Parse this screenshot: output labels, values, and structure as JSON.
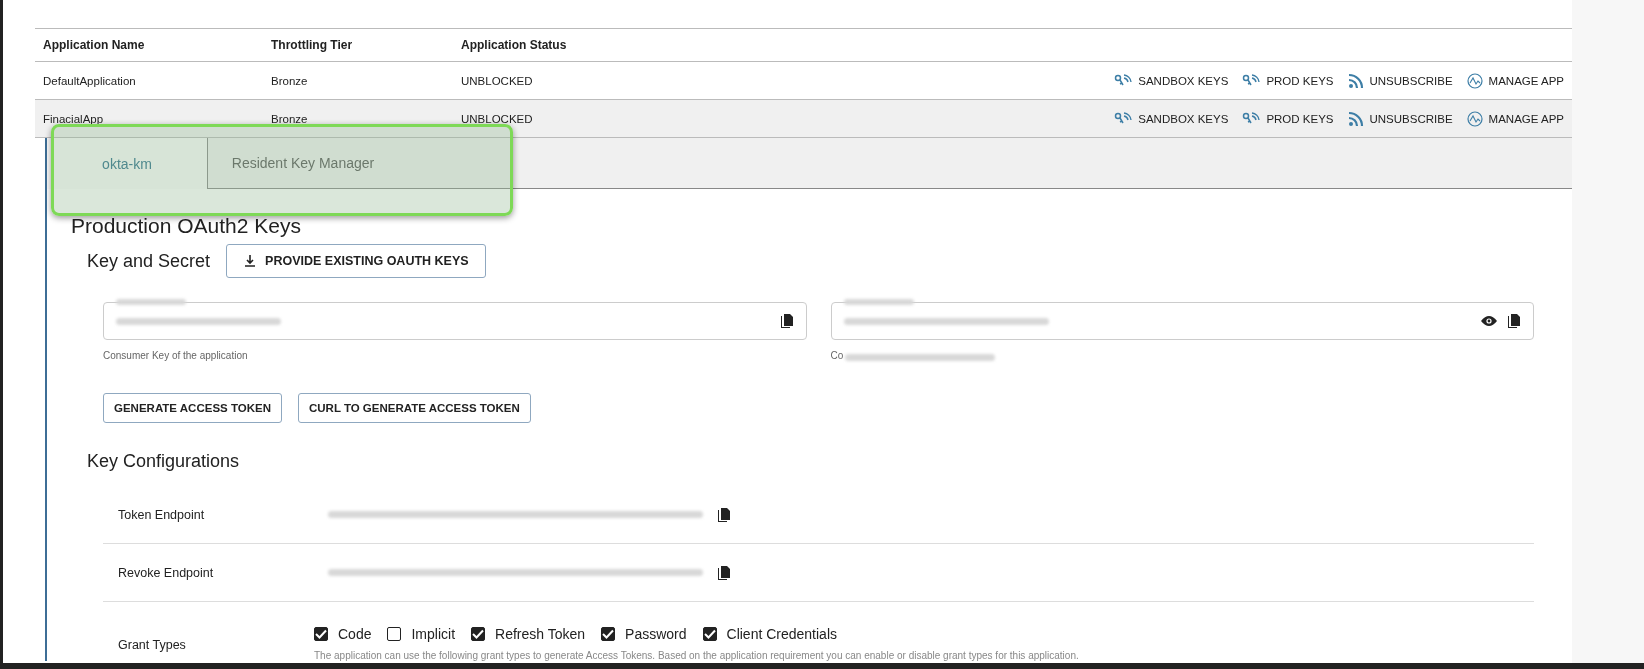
{
  "table": {
    "columns": [
      "Application Name",
      "Throttling Tier",
      "Application Status"
    ],
    "rows": [
      {
        "name": "DefaultApplication",
        "tier": "Bronze",
        "status": "UNBLOCKED",
        "selected": false,
        "actions": [
          "SANDBOX KEYS",
          "PROD KEYS",
          "UNSUBSCRIBE",
          "MANAGE APP"
        ]
      },
      {
        "name": "FinacialApp",
        "tier": "Bronze",
        "status": "UNBLOCKED",
        "selected": true,
        "actions": [
          "SANDBOX KEYS",
          "PROD KEYS",
          "UNSUBSCRIBE",
          "MANAGE APP"
        ]
      }
    ]
  },
  "tabs": [
    {
      "label": "okta-km",
      "selected": true
    },
    {
      "label": "Resident Key Manager",
      "selected": false
    }
  ],
  "highlight": {
    "on": true
  },
  "keys": {
    "title": "Production OAuth2 Keys",
    "section": "Key and Secret",
    "provide_button": "PROVIDE EXISTING OAUTH KEYS",
    "consumer_key": {
      "helper": "Consumer Key of the application"
    },
    "consumer_secret": {
      "helper": "Co"
    },
    "buttons": [
      "GENERATE ACCESS TOKEN",
      "CURL TO GENERATE ACCESS TOKEN"
    ]
  },
  "config": {
    "title": "Key Configurations",
    "endpoints": [
      {
        "label": "Token Endpoint"
      },
      {
        "label": "Revoke Endpoint"
      }
    ],
    "grant_label": "Grant Types",
    "grant_types": [
      {
        "label": "Code",
        "checked": true
      },
      {
        "label": "Implicit",
        "checked": false
      },
      {
        "label": "Refresh Token",
        "checked": true
      },
      {
        "label": "Password",
        "checked": true
      },
      {
        "label": "Client Credentials",
        "checked": true
      }
    ],
    "note": "The application can use the following grant types to generate Access Tokens. Based on the application requirement you can enable or disable grant types for this application."
  }
}
